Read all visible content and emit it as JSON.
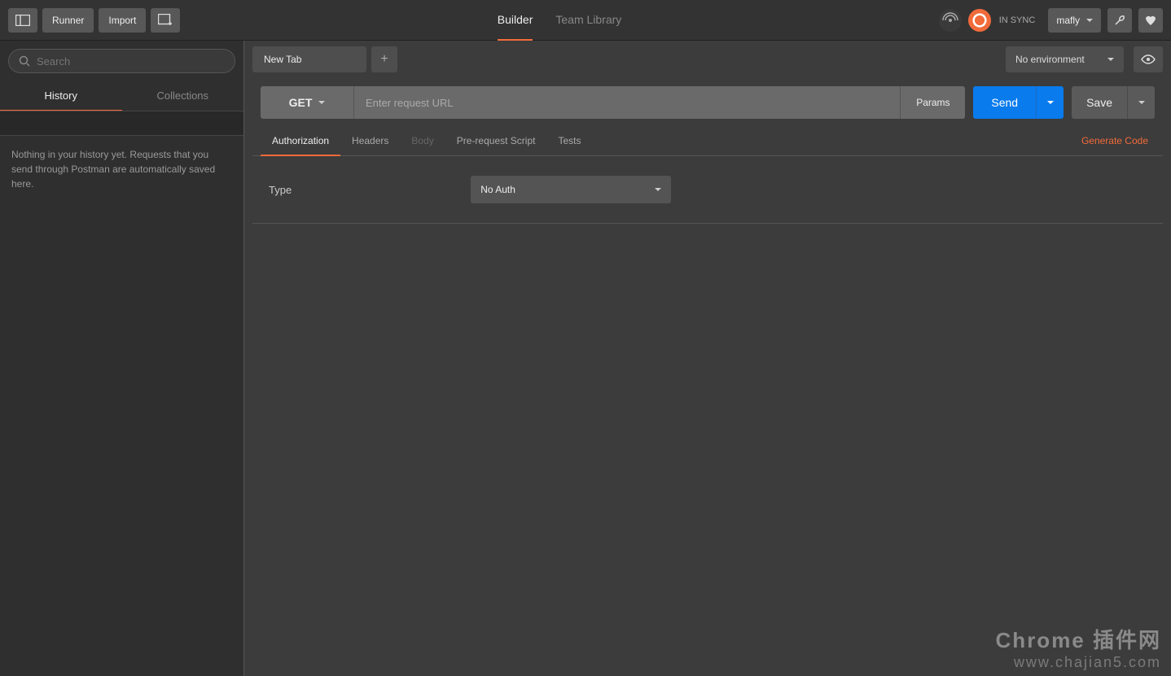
{
  "topbar": {
    "runner": "Runner",
    "import": "Import",
    "builder_tab": "Builder",
    "team_library_tab": "Team Library",
    "sync_status": "IN SYNC",
    "username": "mafly"
  },
  "sidebar": {
    "search_placeholder": "Search",
    "tabs": {
      "history": "History",
      "collections": "Collections"
    },
    "empty_message": "Nothing in your history yet. Requests that you send through Postman are automatically saved here."
  },
  "requestTabs": {
    "tab0": "New Tab",
    "environment": "No environment"
  },
  "request": {
    "method": "GET",
    "url_placeholder": "Enter request URL",
    "params": "Params",
    "send": "Send",
    "save": "Save",
    "tabs": {
      "authorization": "Authorization",
      "headers": "Headers",
      "body": "Body",
      "prerequest": "Pre-request Script",
      "tests": "Tests"
    },
    "generate_code": "Generate Code",
    "auth": {
      "type_label": "Type",
      "type_value": "No Auth"
    }
  },
  "watermark": {
    "line1": "Chrome 插件网",
    "line2": "www.chajian5.com"
  }
}
